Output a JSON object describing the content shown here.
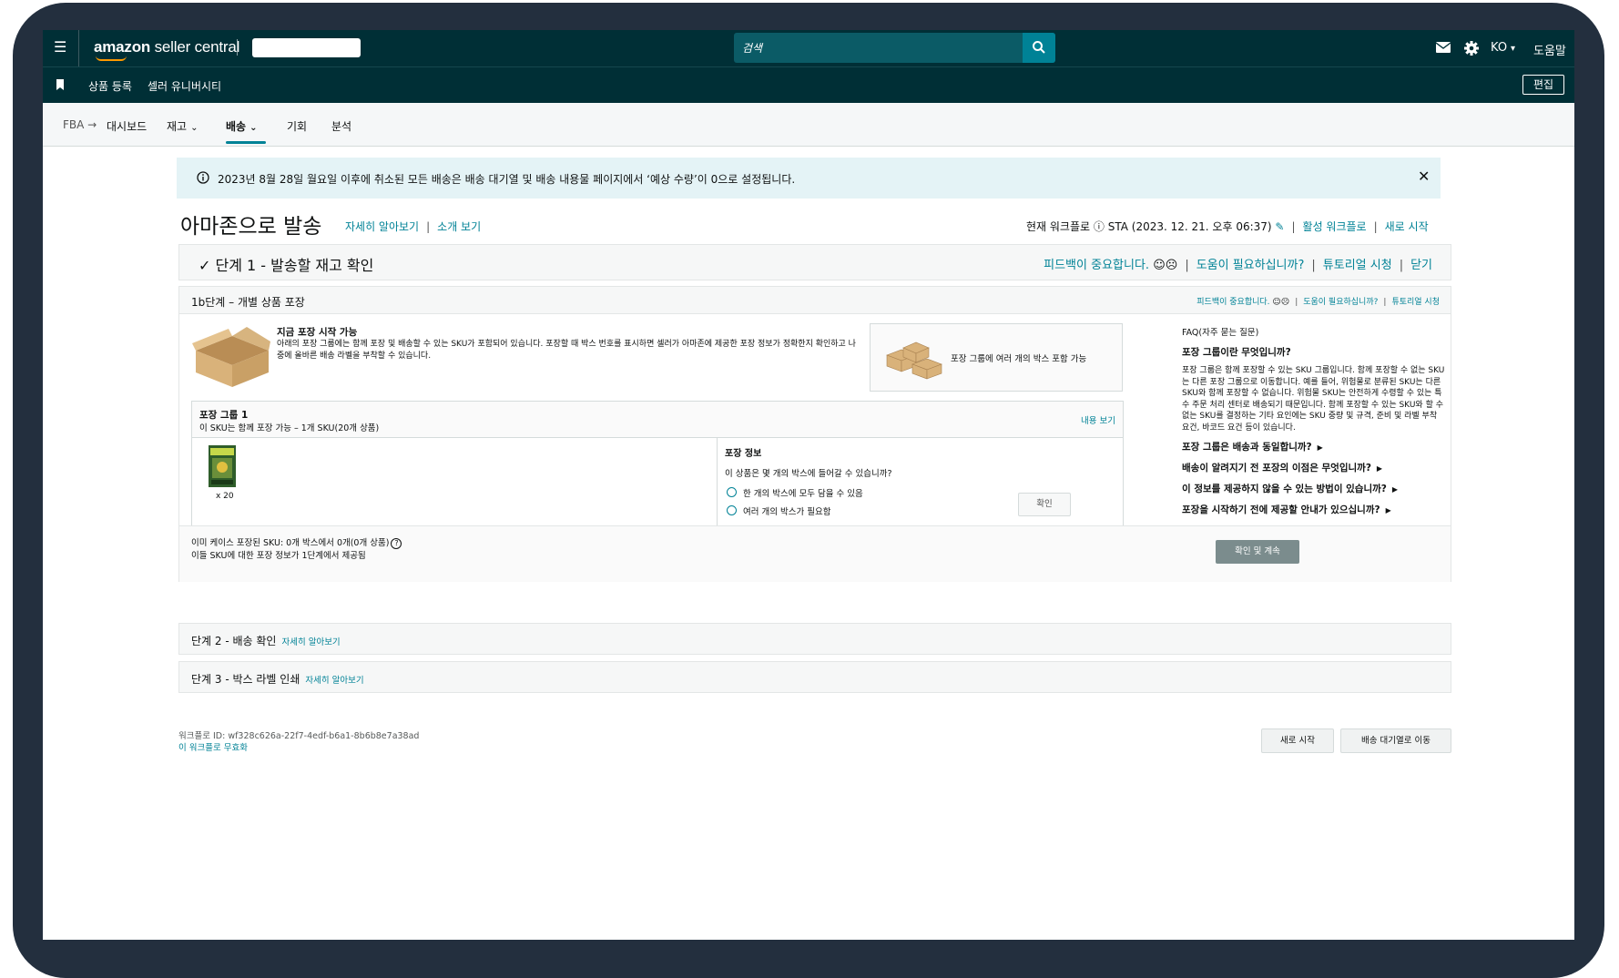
{
  "topbar": {
    "logo_bold": "amazon",
    "logo_rest": " seller central",
    "search_placeholder": "검색",
    "lang": "KO",
    "help": "도움말"
  },
  "secondbar": {
    "links": [
      "상품 등록",
      "셀러 유니버시티"
    ],
    "edit": "편집"
  },
  "nav": {
    "crumb": "FBA",
    "items": [
      "대시보드",
      "재고",
      "배송",
      "기회",
      "분석"
    ]
  },
  "alert": {
    "text": "2023년 8월 28일 월요일 이후에 취소된 모든 배송은 배송 대기열 및 배송 내용물 페이지에서 ‘예상 수량’이 0으로 설정됩니다."
  },
  "page": {
    "title": "아마존으로 발송",
    "learn_more": "자세히 알아보기",
    "intro_video": "소개 보기",
    "workflow_label": "현재 워크플로",
    "workflow_value": "STA (2023. 12. 21. 오후 06:37)",
    "active_workflow": "활성 워크플로",
    "restart": "새로 시작"
  },
  "step1": {
    "title": "단계 1 - 발송할 재고 확인",
    "feedback": "피드백이 중요합니다.",
    "need_help": "도움이 필요하십니까?",
    "tutorial": "튜토리얼 시청",
    "close": "닫기"
  },
  "card": {
    "title": "1b단계 – 개별 상품 포장",
    "feedback": "피드백이 중요합니다.",
    "need_help": "도움이 필요하십니까?",
    "tutorial": "튜토리얼 시청",
    "intro_title": "지금 포장 시작 가능",
    "intro_text": "아래의 포장 그룹에는 함께 포장 및 배송할 수 있는 SKU가 포함되어 있습니다. 포장할 때 박스 번호를 표시하면 셀러가 아마존에 제공한 포장 정보가 정확한지 확인하고 나중에 올바른 배송 라벨을 부착할 수 있습니다.",
    "multi_box": "포장 그룹에 여러 개의 박스 포함 가능",
    "group_title": "포장 그룹 1",
    "group_sub": "이 SKU는 함께 포장 가능 – 1개 SKU(20개 상품)",
    "view_contents": "내용 보기",
    "quantity": "x 20",
    "packing_info": "포장 정보",
    "question": "이 상품은 몇 개의 박스에 들어갈 수 있습니까?",
    "option1": "한 개의 박스에 모두 담을 수 있음",
    "option2": "여러 개의 박스가 필요함",
    "confirm": "확인",
    "case_packed": "이미 케이스 포장된 SKU: 0개 박스에서 0개(0개 상품)",
    "case_packed_note": "이들 SKU에 대한 포장 정보가 1단계에서 제공됨",
    "confirm_continue": "확인 및 계속"
  },
  "faq": {
    "header": "FAQ(자주 묻는 질문)",
    "q1": "포장 그룹이란 무엇입니까?",
    "a1": "포장 그룹은 함께 포장할 수 있는 SKU 그룹입니다. 함께 포장할 수 없는 SKU는 다른 포장 그룹으로 이동합니다. 예를 들어, 위험물로 분류된 SKU는 다른 SKU와 함께 포장할 수 없습니다. 위험물 SKU는 안전하게 수령할 수 있는 특수 주문 처리 센터로 배송되기 때문입니다. 함께 포장할 수 있는 SKU와 할 수 없는 SKU를 결정하는 기타 요인에는 SKU 중량 및 규격, 준비 및 라벨 부착 요건, 바코드 요건 등이 있습니다.",
    "questions": [
      "포장 그룹은 배송과 동일합니까?",
      "배송이 알려지기 전 포장의 이점은 무엇입니까?",
      "이 정보를 제공하지 않을 수 있는 방법이 있습니까?",
      "포장을 시작하기 전에 제공할 안내가 있으십니까?"
    ]
  },
  "step2": {
    "title": "단계 2 - 배송 확인",
    "link": "자세히 알아보기"
  },
  "step3": {
    "title": "단계 3 - 박스 라벨 인쇄",
    "link": "자세히 알아보기"
  },
  "footer": {
    "workflow_id": "워크플로 ID: wf328c626a-22f7-4edf-b6a1-8b6b8e7a38ad",
    "disable": "이 워크플로 무효화",
    "restart": "새로 시작",
    "go_queue": "배송 대기열로 이동"
  },
  "colors": {
    "accent": "#008296",
    "header": "#002f36",
    "frame": "#232f3e",
    "alert_bg": "#e4f3f6"
  }
}
